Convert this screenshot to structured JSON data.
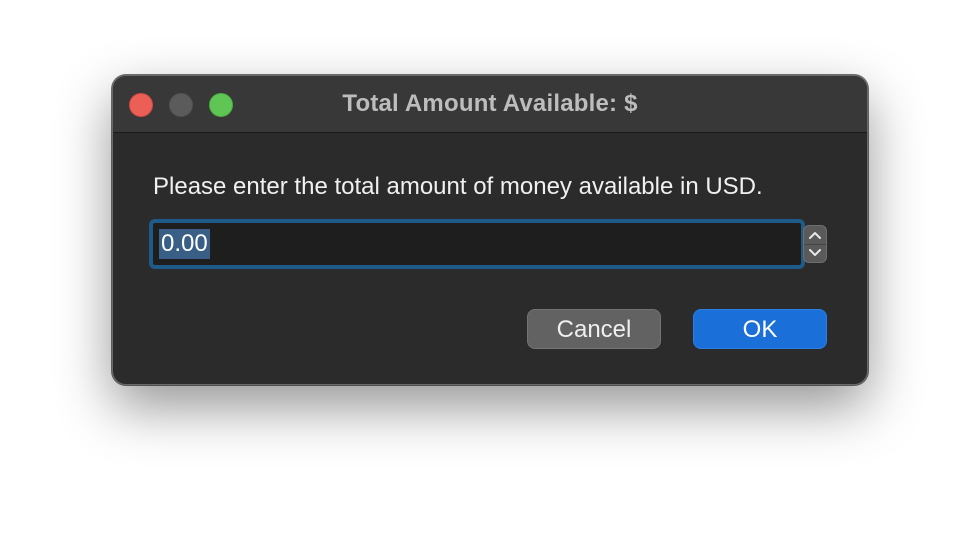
{
  "dialog": {
    "title": "Total Amount Available: $",
    "message": "Please enter the total amount of money available in USD.",
    "input": {
      "value": "0.00"
    },
    "buttons": {
      "cancel_label": "Cancel",
      "ok_label": "OK"
    }
  },
  "window_controls": [
    {
      "name": "close",
      "color": "#ec5f56"
    },
    {
      "name": "minimize",
      "color": "#5b5b5b"
    },
    {
      "name": "zoom",
      "color": "#5fc655"
    }
  ],
  "colors": {
    "accent": "#1b6fd8",
    "focus_ring": "#1f5b88",
    "selection": "#3a5f87",
    "window_bg": "#2b2b2b",
    "titlebar_bg": "#383838"
  },
  "icons": {
    "stepper_up": "chevron-up-icon",
    "stepper_down": "chevron-down-icon"
  }
}
